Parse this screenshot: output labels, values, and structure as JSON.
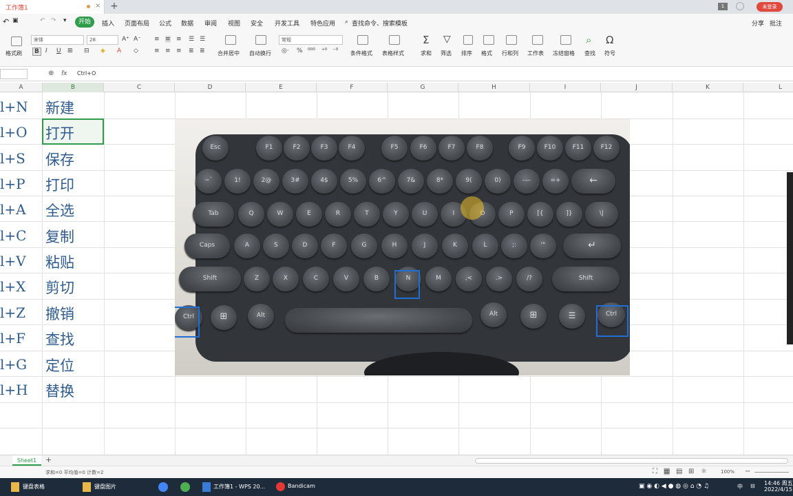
{
  "titlebar": {
    "doc_tab": "工作簿1",
    "login_label": "未登录",
    "badge": "1"
  },
  "menu": {
    "items": [
      "开始",
      "插入",
      "页面布局",
      "公式",
      "数据",
      "审阅",
      "视图",
      "安全",
      "开发工具",
      "特色应用"
    ],
    "search": "查找命令、搜索模板",
    "share": "分享",
    "comment": "批注"
  },
  "ribbon": {
    "format_painter": "格式刷",
    "font": "宋体",
    "size": "28",
    "number_format": "常规",
    "labels": [
      "合并居中",
      "自动换行",
      "条件格式",
      "表格样式",
      "求和",
      "筛选",
      "排序",
      "格式",
      "行和列",
      "工作表",
      "冻结窗格",
      "查找",
      "符号"
    ]
  },
  "formula": {
    "fx": "fx",
    "value": "Ctrl+O"
  },
  "columns": [
    "A",
    "B",
    "C",
    "D",
    "E",
    "F",
    "G",
    "H",
    "I",
    "J",
    "K",
    "L"
  ],
  "rows": [
    {
      "a": "l+N",
      "b": "新建"
    },
    {
      "a": "l+O",
      "b": "打开"
    },
    {
      "a": "l+S",
      "b": "保存"
    },
    {
      "a": "l+P",
      "b": "打印"
    },
    {
      "a": "l+A",
      "b": "全选"
    },
    {
      "a": "l+C",
      "b": "复制"
    },
    {
      "a": "l+V",
      "b": "粘贴"
    },
    {
      "a": "l+X",
      "b": "剪切"
    },
    {
      "a": "l+Z",
      "b": "撤销"
    },
    {
      "a": "l+F",
      "b": "查找"
    },
    {
      "a": "l+G",
      "b": "定位"
    },
    {
      "a": "l+H",
      "b": "替换"
    }
  ],
  "keyboard": {
    "fn_row": [
      "Esc",
      "F1",
      "F2",
      "F3",
      "F4",
      "F5",
      "F6",
      "F7",
      "F8",
      "F9",
      "F10",
      "F11",
      "F12"
    ],
    "num_row": [
      "~`",
      "1!",
      "2@",
      "3#",
      "4$",
      "5%",
      "6^",
      "7&",
      "8*",
      "9(",
      "0)",
      "-—",
      "=+",
      "←"
    ],
    "q_row": [
      "Tab",
      "Q",
      "W",
      "E",
      "R",
      "T",
      "Y",
      "U",
      "I",
      "O",
      "P",
      "[{",
      "]}",
      "\\|"
    ],
    "a_row": [
      "Caps",
      "A",
      "S",
      "D",
      "F",
      "G",
      "H",
      "J",
      "K",
      "L",
      ";:",
      "'\"",
      "↵"
    ],
    "z_row": [
      "Shift",
      "Z",
      "X",
      "C",
      "V",
      "B",
      "N",
      "M",
      ",<",
      ".>",
      "/?",
      "Shift"
    ],
    "bottom_row": [
      "Ctrl",
      "⊞",
      "Alt",
      "Alt",
      "⊞",
      "☰",
      "Ctrl"
    ]
  },
  "sheet": {
    "name": "Sheet1",
    "add": "+"
  },
  "status": {
    "summary": "求和=0  平均值=0  计数=2",
    "zoom": "100%"
  },
  "taskbar": {
    "items": [
      "键盘表格",
      "键盘图片",
      "工作簿1 - WPS 20...",
      "Bandicam"
    ],
    "time": "14:46 周五",
    "date": "2022/4/15",
    "ime": "中"
  }
}
